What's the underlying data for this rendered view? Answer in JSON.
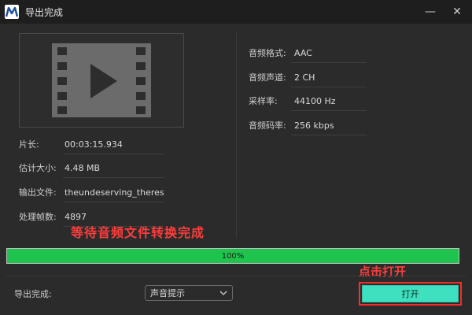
{
  "window": {
    "title": "导出完成",
    "minimize_symbol": "—",
    "close_symbol": "✕"
  },
  "video_info": [
    {
      "label": "片长:",
      "value": "00:03:15.934"
    },
    {
      "label": "估计大小:",
      "value": "4.48 MB"
    },
    {
      "label": "输出文件:",
      "value": "theundeserving_theresnot"
    },
    {
      "label": "处理帧数:",
      "value": "4897"
    }
  ],
  "audio_info": [
    {
      "label": "音频格式:",
      "value": "AAC"
    },
    {
      "label": "音频声道:",
      "value": "2 CH"
    },
    {
      "label": "采样率:",
      "value": "44100 Hz"
    },
    {
      "label": "音频码率:",
      "value": "256 kbps"
    }
  ],
  "annotations": {
    "wait_text": "等待音频文件转换完成",
    "click_text": "点击打开"
  },
  "progress": {
    "fraction": 1.0,
    "label": "100%",
    "color": "#1fc44e"
  },
  "footer": {
    "label": "导出完成:",
    "select_value": "声音提示",
    "open_button": "打开"
  },
  "colors": {
    "accent_button": "#3ee0bf",
    "annotation": "#ff3d3d"
  },
  "icons": {
    "thumbnail": "video-film-icon",
    "select_chevron": "chevron-down-icon"
  }
}
